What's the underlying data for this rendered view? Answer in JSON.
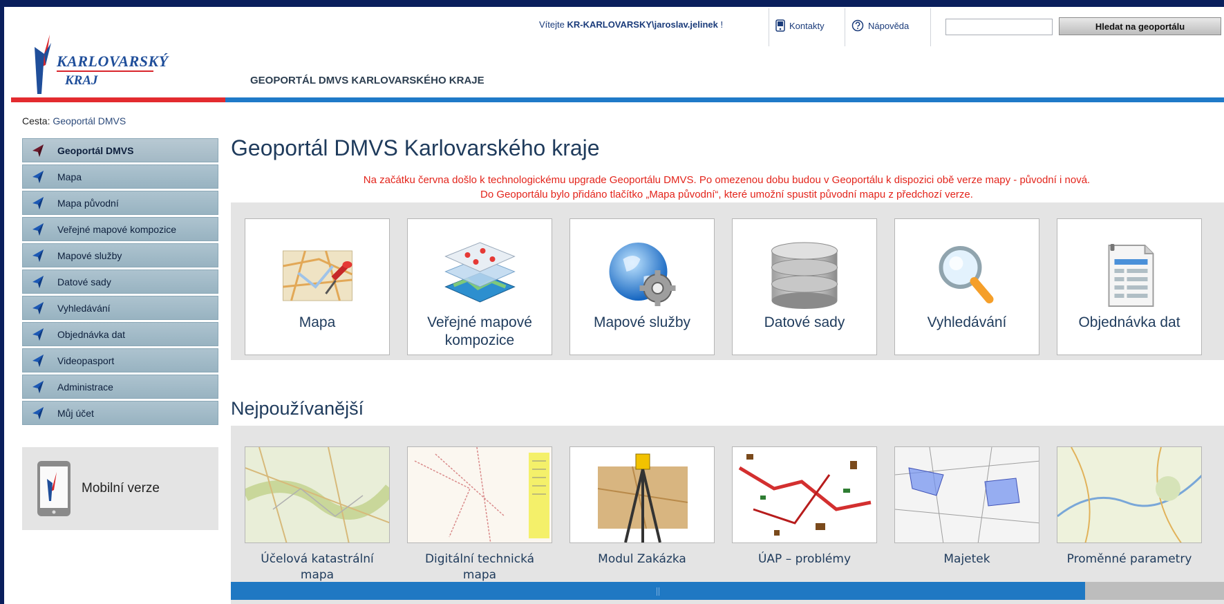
{
  "header": {
    "logo": {
      "line1": "KARLOVARSKÝ",
      "line2": "KRAJ"
    },
    "site_name": "GEOPORTÁL DMVS KARLOVARSKÉHO KRAJE",
    "welcome_prefix": "Vítejte",
    "username": "KR-KARLOVARSKY\\jaroslav.jelinek",
    "welcome_suffix": " !",
    "contacts": "Kontakty",
    "help": "Nápověda",
    "search_button": "Hledat na geoportálu",
    "search_value": ""
  },
  "breadcrumb": {
    "label": "Cesta:",
    "current": "Geoportál DMVS"
  },
  "sidebar": {
    "items": [
      {
        "label": "Geoportál DMVS",
        "active": true
      },
      {
        "label": "Mapa"
      },
      {
        "label": "Mapa původní"
      },
      {
        "label": "Veřejné mapové kompozice"
      },
      {
        "label": "Mapové služby"
      },
      {
        "label": "Datové sady"
      },
      {
        "label": "Vyhledávání"
      },
      {
        "label": "Objednávka dat"
      },
      {
        "label": "Videopasport"
      },
      {
        "label": "Administrace"
      },
      {
        "label": "Můj účet"
      }
    ],
    "mobile": "Mobilní verze"
  },
  "main": {
    "title": "Geoportál DMVS Karlovarského kraje",
    "notice_line1": "Na začátku června došlo k technologickému upgrade Geoportálu DMVS. Po omezenou dobu budou v Geoportálu k dispozici obě verze mapy - původní i nová.",
    "notice_line2": "Do Geoportálu bylo přidáno tlačítko „Mapa původní“, které umožní spustit původní mapu z předchozí verze.",
    "tiles": [
      {
        "label": "Mapa",
        "icon": "map-pin-icon"
      },
      {
        "label": "Veřejné mapové kompozice",
        "icon": "map-layers-icon"
      },
      {
        "label": "Mapové služby",
        "icon": "globe-gear-icon"
      },
      {
        "label": "Datové sady",
        "icon": "database-icon"
      },
      {
        "label": "Vyhledávání",
        "icon": "magnifier-icon"
      },
      {
        "label": "Objednávka dat",
        "icon": "order-form-icon"
      }
    ],
    "most_used_title": "Nejpoužívanější",
    "most_used": [
      {
        "label": "Účelová katastrální mapa"
      },
      {
        "label": "Digitální technická mapa"
      },
      {
        "label": "Modul Zakázka"
      },
      {
        "label": "ÚAP – problémy"
      },
      {
        "label": "Majetek"
      },
      {
        "label": "Proměnné parametry"
      }
    ],
    "scroll_position": 0.86
  },
  "colors": {
    "brand_red": "#e32b2f",
    "brand_blue": "#1f7ac8",
    "notice": "#e3241b",
    "background": "#0a1f5c"
  }
}
